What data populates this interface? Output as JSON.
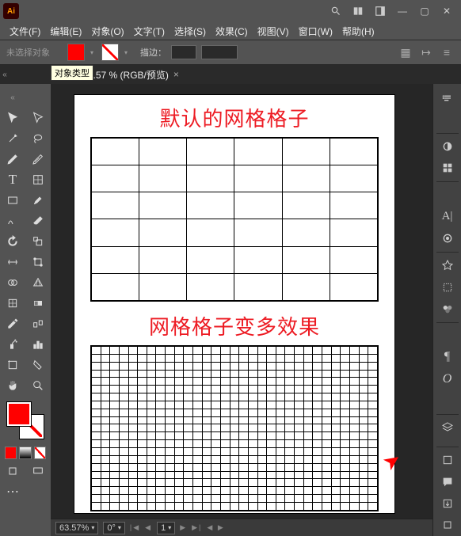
{
  "app": {
    "name": "Ai"
  },
  "window": {
    "min": "—",
    "max": "▢",
    "close": "✕"
  },
  "menu": {
    "file": "文件(F)",
    "edit": "编辑(E)",
    "object": "对象(O)",
    "type": "文字(T)",
    "select": "选择(S)",
    "effect": "效果(C)",
    "view": "视图(V)",
    "window": "窗口(W)",
    "help": "帮助(H)"
  },
  "options": {
    "no_selection": "未选择对象",
    "stroke_label": "描边：",
    "stroke_width": ""
  },
  "tooltip": "对象类型",
  "document": {
    "tab_label": "-1* @ 63.57 % (RGB/预览)",
    "close": "×"
  },
  "canvas": {
    "title1": "默认的网格格子",
    "title2": "网格格子变多效果"
  },
  "status": {
    "zoom": "63.57%",
    "angle": "0°",
    "artboard": "1",
    "artboard_total": "1"
  }
}
